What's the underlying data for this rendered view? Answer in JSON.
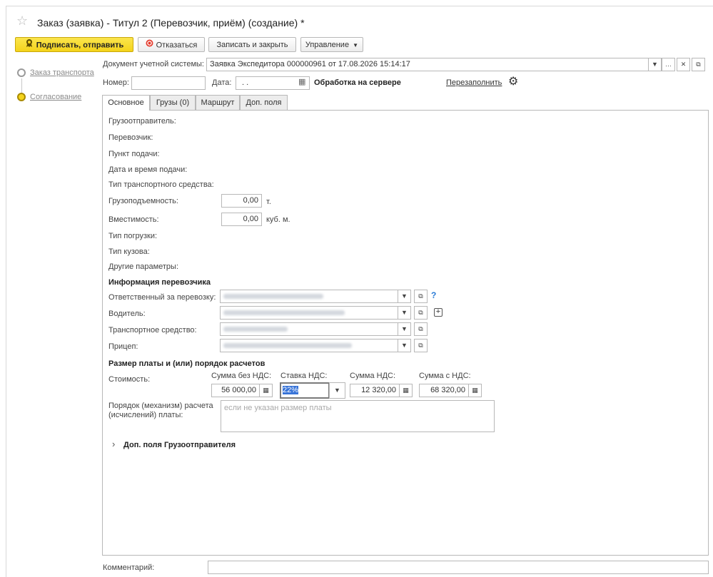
{
  "window": {
    "title": "Заказ (заявка) - Титул 2 (Перевозчик, приём) (создание) *"
  },
  "toolbar": {
    "sign_send": "Подписать, отправить",
    "decline": "Отказаться",
    "save_close": "Записать и закрыть",
    "manage": "Управление"
  },
  "steps": [
    {
      "label": "Заказ транспорта",
      "state": "pending"
    },
    {
      "label": "Согласование",
      "state": "current"
    }
  ],
  "header": {
    "doc_label": "Документ учетной системы:",
    "doc_value": "Заявка Экспедитора 000000961 от 17.08.2026 15:14:17",
    "number_label": "Номер:",
    "number_value": "",
    "date_label": "Дата:",
    "date_value": ". .",
    "server_processing": "Обработка на сервере",
    "refill": "Перезаполнить"
  },
  "tabs": [
    {
      "label": "Основное",
      "active": true
    },
    {
      "label": "Грузы (0)",
      "active": false
    },
    {
      "label": "Маршрут",
      "active": false
    },
    {
      "label": "Доп. поля",
      "active": false
    }
  ],
  "main": {
    "shipper": "Грузоотправитель:",
    "carrier": "Перевозчик:",
    "pickup_point": "Пункт подачи:",
    "pickup_datetime": "Дата и время подачи:",
    "vehicle_type": "Тип транспортного средства:",
    "capacity_label": "Грузоподъемность:",
    "capacity_value": "0,00",
    "capacity_unit": "т.",
    "volume_label": "Вместимость:",
    "volume_value": "0,00",
    "volume_unit": "куб. м.",
    "loading_type": "Тип погрузки:",
    "body_type": "Тип кузова:",
    "other_params": "Другие параметры:"
  },
  "carrier_info": {
    "title": "Информация перевозчика",
    "responsible_label": "Ответственный за перевозку:",
    "driver_label": "Водитель:",
    "vehicle_label": "Транспортное средство:",
    "trailer_label": "Прицеп:",
    "help_mark": "?"
  },
  "payment": {
    "title": "Размер платы и (или) порядок расчетов",
    "cost_label": "Стоимость:",
    "sum_no_vat_label": "Сумма без НДС:",
    "sum_no_vat": "56 000,00",
    "vat_rate_label": "Ставка НДС:",
    "vat_rate": "22%",
    "vat_sum_label": "Сумма НДС:",
    "vat_sum": "12 320,00",
    "sum_with_vat_label": "Сумма с НДС:",
    "sum_with_vat": "68 320,00",
    "order_label_1": "Порядок (механизм) расчета",
    "order_label_2": "(исчислений) платы:",
    "order_placeholder": "если не указан размер платы"
  },
  "shipper_extra": {
    "title": "Доп. поля Грузоотправителя"
  },
  "footer": {
    "comment_label": "Комментарий:",
    "comment_value": ""
  },
  "colors": {
    "accent_yellow": "#f4d31b",
    "link_gray": "#8a8a8a",
    "selection_blue": "#3874d8"
  }
}
